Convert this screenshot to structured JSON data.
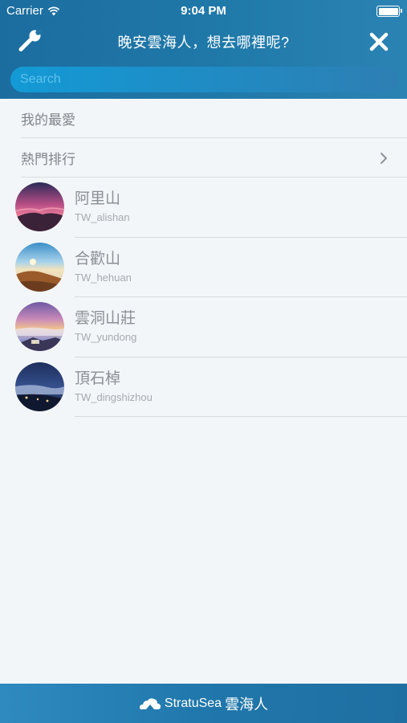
{
  "status_bar": {
    "carrier": "Carrier",
    "time": "9:04 PM"
  },
  "nav": {
    "title": "晚安雲海人，想去哪裡呢?",
    "left_icon": "wrench-icon",
    "right_icon": "close-icon"
  },
  "search": {
    "placeholder": "Search",
    "value": ""
  },
  "sections": [
    {
      "label": "我的最愛"
    },
    {
      "label": "熱門排行",
      "icon": "chevron-right-icon"
    }
  ],
  "places": [
    {
      "name": "阿里山",
      "code": "TW_alishan"
    },
    {
      "name": "合歡山",
      "code": "TW_hehuan"
    },
    {
      "name": "雲洞山莊",
      "code": "TW_yundong"
    },
    {
      "name": "頂石棹",
      "code": "TW_dingshizhou"
    }
  ],
  "footer": {
    "brand": "StratuSea",
    "brand_zh": "雲海人",
    "icon": "cloud-logo-icon"
  },
  "colors": {
    "header": "#1f76a7",
    "search_bar": "#139ad6",
    "footer": "#2077ab",
    "background": "#f3f6f8"
  }
}
